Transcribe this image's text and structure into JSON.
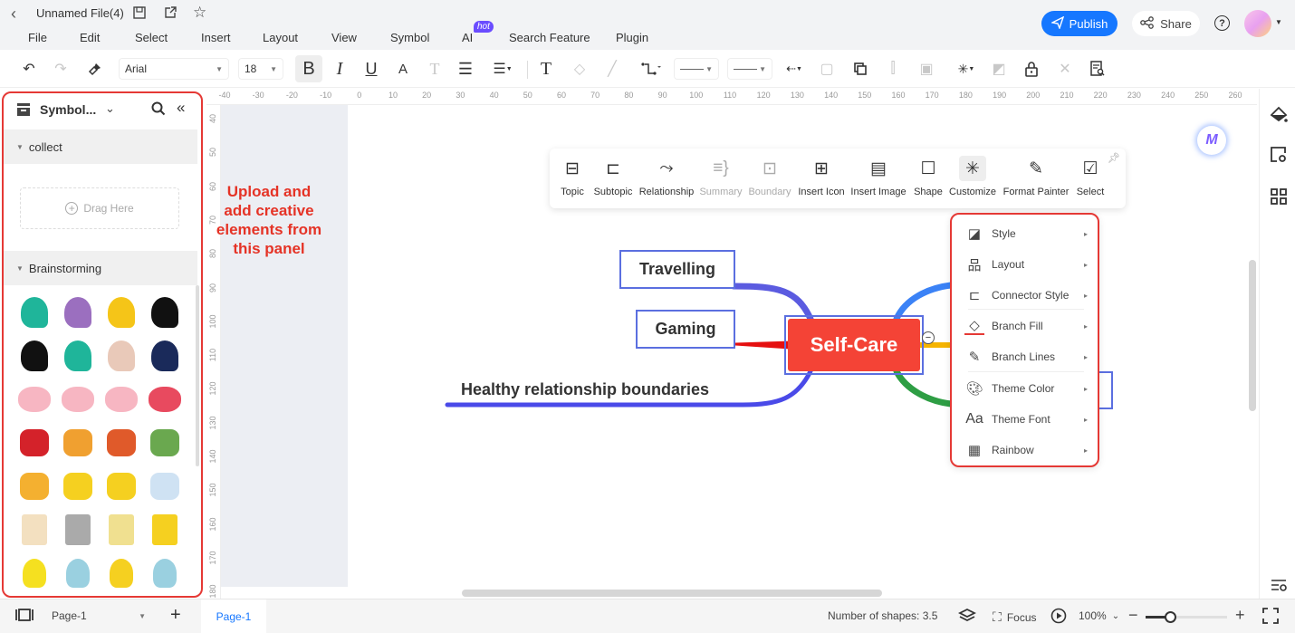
{
  "titlebar": {
    "file_name": "Unnamed File(4)",
    "menu": [
      "File",
      "Edit",
      "Select",
      "Insert",
      "Layout",
      "View",
      "Symbol",
      "AI",
      "Search Feature",
      "Plugin"
    ],
    "ai_badge": "hot",
    "publish_label": "Publish",
    "share_label": "Share"
  },
  "toolbar": {
    "font_family": "Arial",
    "font_size": "18"
  },
  "left_panel": {
    "title": "Symbol...",
    "sections": [
      {
        "label": "collect"
      },
      {
        "label": "Brainstorming"
      }
    ],
    "drag_here": "Drag Here",
    "symbols": [
      "head-lightbulb",
      "head-brain-purple",
      "head-gears-yellow",
      "head-brain-black",
      "head-explosion",
      "head-key",
      "head-paint",
      "head-brain-navy",
      "brain-pink",
      "brain-split",
      "brain-pink-2",
      "brain-lightning",
      "gears-red",
      "wrench-gears",
      "people-talking",
      "eye-target",
      "speech-bubbles",
      "explosion-cloud",
      "explosion",
      "whiteboard",
      "checklist",
      "writing-list",
      "notepad-pencil",
      "bulb-lightning",
      "bulb-yellow",
      "bulb-gears",
      "bulb-half-brain",
      "bulb-sprout"
    ]
  },
  "annotation": "Upload and add creative elements from this panel",
  "ruler": {
    "h_ticks": [
      "-40",
      "-30",
      "-20",
      "-10",
      "0",
      "10",
      "20",
      "30",
      "40",
      "50",
      "60",
      "70",
      "80",
      "90",
      "100",
      "110",
      "120",
      "130",
      "140",
      "150",
      "160",
      "170",
      "180",
      "190",
      "200",
      "210",
      "220",
      "230",
      "240",
      "250",
      "260"
    ],
    "v_ticks": [
      "40",
      "50",
      "60",
      "70",
      "80",
      "90",
      "100",
      "110",
      "120",
      "130",
      "140",
      "150",
      "160",
      "170",
      "180"
    ]
  },
  "float_toolbar": [
    {
      "label": "Topic",
      "icon": "topic-icon",
      "disabled": false
    },
    {
      "label": "Subtopic",
      "icon": "subtopic-icon",
      "disabled": false
    },
    {
      "label": "Relationship",
      "icon": "relationship-icon",
      "disabled": false
    },
    {
      "label": "Summary",
      "icon": "summary-icon",
      "disabled": true
    },
    {
      "label": "Boundary",
      "icon": "boundary-icon",
      "disabled": true
    },
    {
      "label": "Insert Icon",
      "icon": "insert-icon-icon",
      "disabled": false
    },
    {
      "label": "Insert Image",
      "icon": "insert-image-icon",
      "disabled": false
    },
    {
      "label": "Shape",
      "icon": "shape-icon",
      "disabled": false
    },
    {
      "label": "Customize",
      "icon": "customize-icon",
      "disabled": false
    },
    {
      "label": "Format Painter",
      "icon": "format-painter-icon",
      "disabled": false
    },
    {
      "label": "Select",
      "icon": "select-icon",
      "disabled": false
    }
  ],
  "context_menu": [
    "Style",
    "Layout",
    "Connector Style",
    "Branch Fill",
    "Branch Lines",
    "Theme Color",
    "Theme Font",
    "Rainbow"
  ],
  "mindmap": {
    "central": "Self-Care",
    "topics": [
      "Travelling",
      "Gaming",
      "Healthy relationship boundaries"
    ],
    "colors": {
      "central": "#f44336",
      "travelling": "#5b5be0",
      "gaming": "#e51010",
      "healthy": "#4a4ae8",
      "blue": "#3b82f6",
      "yellow": "#f5b400",
      "green": "#2e9e44"
    }
  },
  "statusbar": {
    "page_select": "Page-1",
    "page_tab": "Page-1",
    "shape_count": "Number of shapes: 3.5",
    "focus_label": "Focus",
    "zoom": "100%",
    "zoom_fraction": 0.3
  }
}
